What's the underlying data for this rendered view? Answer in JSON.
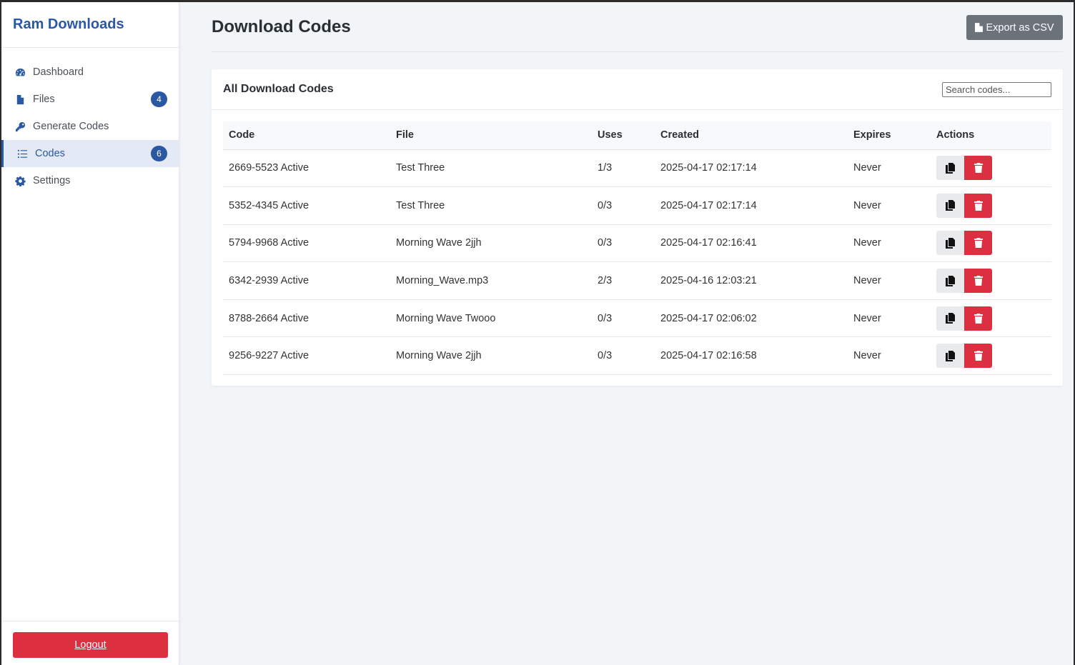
{
  "app": {
    "brand": "Ram Downloads"
  },
  "sidebar": {
    "items": [
      {
        "label": "Dashboard",
        "icon": "gauge-icon"
      },
      {
        "label": "Files",
        "icon": "file-icon",
        "badge": "4"
      },
      {
        "label": "Generate Codes",
        "icon": "key-icon"
      },
      {
        "label": "Codes",
        "icon": "list-icon",
        "badge": "6",
        "active": true
      },
      {
        "label": "Settings",
        "icon": "gear-icon"
      }
    ],
    "logout_label": "Logout"
  },
  "page": {
    "title": "Download Codes",
    "export_label": "Export as CSV"
  },
  "card": {
    "title": "All Download Codes",
    "search_placeholder": "Search codes..."
  },
  "table": {
    "headers": [
      "Code",
      "File",
      "Uses",
      "Created",
      "Expires",
      "Actions"
    ],
    "rows": [
      {
        "code": "2669-5523 Active",
        "file": "Test Three",
        "uses": "1/3",
        "created": "2025-04-17 02:17:14",
        "expires": "Never"
      },
      {
        "code": "5352-4345 Active",
        "file": "Test Three",
        "uses": "0/3",
        "created": "2025-04-17 02:17:14",
        "expires": "Never"
      },
      {
        "code": "5794-9968 Active",
        "file": "Morning Wave 2jjh",
        "uses": "0/3",
        "created": "2025-04-17 02:16:41",
        "expires": "Never"
      },
      {
        "code": "6342-2939 Active",
        "file": "Morning_Wave.mp3",
        "uses": "2/3",
        "created": "2025-04-16 12:03:21",
        "expires": "Never"
      },
      {
        "code": "8788-2664 Active",
        "file": "Morning Wave Twooo",
        "uses": "0/3",
        "created": "2025-04-17 02:06:02",
        "expires": "Never"
      },
      {
        "code": "9256-9227 Active",
        "file": "Morning Wave 2jjh",
        "uses": "0/3",
        "created": "2025-04-17 02:16:58",
        "expires": "Never"
      }
    ]
  },
  "colors": {
    "brand": "#2b58a2",
    "danger": "#dc2f3f",
    "export_button": "#6b727a"
  }
}
